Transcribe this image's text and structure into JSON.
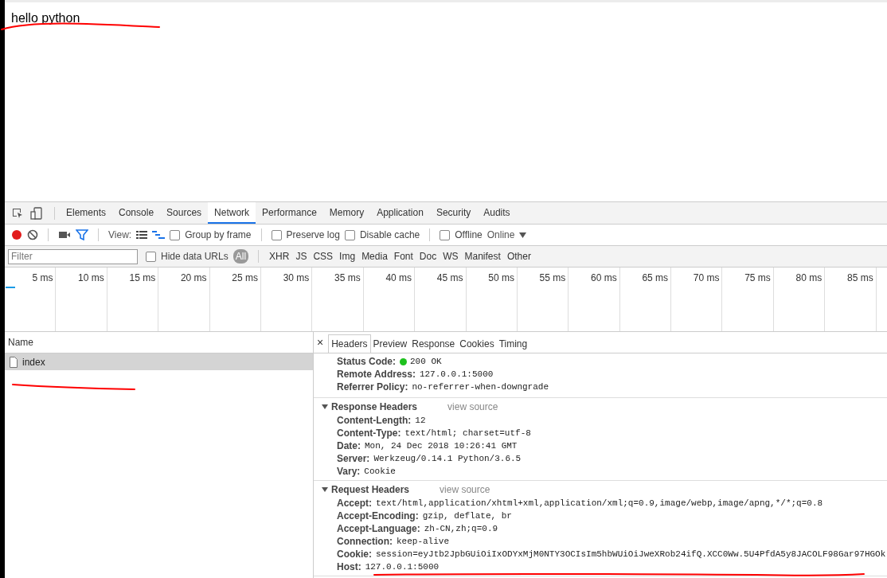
{
  "page": {
    "text": "hello python"
  },
  "devtools": {
    "tabs": [
      {
        "label": "Elements",
        "selected": false
      },
      {
        "label": "Console",
        "selected": false
      },
      {
        "label": "Sources",
        "selected": false
      },
      {
        "label": "Network",
        "selected": true
      },
      {
        "label": "Performance",
        "selected": false
      },
      {
        "label": "Memory",
        "selected": false
      },
      {
        "label": "Application",
        "selected": false
      },
      {
        "label": "Security",
        "selected": false
      },
      {
        "label": "Audits",
        "selected": false
      }
    ],
    "toolbar": {
      "recording": true,
      "view_label": "View:",
      "checkboxes": [
        {
          "label": "Group by frame",
          "checked": false
        },
        {
          "label": "Preserve log",
          "checked": false
        },
        {
          "label": "Disable cache",
          "checked": false
        },
        {
          "label": "Offline",
          "checked": false
        }
      ],
      "throttling": "Online"
    },
    "filter_bar": {
      "placeholder": "Filter",
      "hide_data_urls": {
        "label": "Hide data URLs",
        "checked": false
      },
      "types": [
        {
          "label": "All",
          "selected": true
        },
        {
          "label": "XHR",
          "selected": false
        },
        {
          "label": "JS",
          "selected": false
        },
        {
          "label": "CSS",
          "selected": false
        },
        {
          "label": "Img",
          "selected": false
        },
        {
          "label": "Media",
          "selected": false
        },
        {
          "label": "Font",
          "selected": false
        },
        {
          "label": "Doc",
          "selected": false
        },
        {
          "label": "WS",
          "selected": false
        },
        {
          "label": "Manifest",
          "selected": false
        },
        {
          "label": "Other",
          "selected": false
        }
      ]
    },
    "timeline_ticks": [
      "5 ms",
      "10 ms",
      "15 ms",
      "20 ms",
      "25 ms",
      "30 ms",
      "35 ms",
      "40 ms",
      "45 ms",
      "50 ms",
      "55 ms",
      "60 ms",
      "65 ms",
      "70 ms",
      "75 ms",
      "80 ms",
      "85 ms"
    ],
    "requests": {
      "column": "Name",
      "rows": [
        {
          "name": "index",
          "selected": true
        }
      ]
    },
    "detail_close": "×",
    "detail_tabs": [
      {
        "label": "Headers",
        "selected": true
      },
      {
        "label": "Preview",
        "selected": false
      },
      {
        "label": "Response",
        "selected": false
      },
      {
        "label": "Cookies",
        "selected": false
      },
      {
        "label": "Timing",
        "selected": false
      }
    ],
    "general_rows": [
      {
        "key": "Status Code:",
        "value": "200 OK",
        "kind": "status"
      },
      {
        "key": "Remote Address:",
        "value": "127.0.0.1:5000",
        "kind": "plain"
      },
      {
        "key": "Referrer Policy:",
        "value": "no-referrer-when-downgrade",
        "kind": "plain"
      }
    ],
    "sections": [
      {
        "title": "Response Headers",
        "link": "view source",
        "expanded": true,
        "rows": [
          {
            "key": "Content-Length:",
            "value": "12"
          },
          {
            "key": "Content-Type:",
            "value": "text/html; charset=utf-8"
          },
          {
            "key": "Date:",
            "value": "Mon, 24 Dec 2018 10:26:41 GMT"
          },
          {
            "key": "Server:",
            "value": "Werkzeug/0.14.1 Python/3.6.5"
          },
          {
            "key": "Vary:",
            "value": "Cookie"
          }
        ]
      },
      {
        "title": "Request Headers",
        "link": "view source",
        "expanded": true,
        "rows": [
          {
            "key": "Accept:",
            "value": "text/html,application/xhtml+xml,application/xml;q=0.9,image/webp,image/apng,*/*;q=0.8"
          },
          {
            "key": "Accept-Encoding:",
            "value": "gzip, deflate, br"
          },
          {
            "key": "Accept-Language:",
            "value": "zh-CN,zh;q=0.9"
          },
          {
            "key": "Connection:",
            "value": "keep-alive"
          },
          {
            "key": "Cookie:",
            "value": "session=eyJtb2JpbGUiOiIxODYxMjM0NTY3OCIsIm5hbWUiOiJweXRob24ifQ.XCC0Ww.5U4PfdA5y8JACOLF98Gar97HGOk"
          },
          {
            "key": "Host:",
            "value": "127.0.0.1:5000"
          }
        ]
      }
    ]
  }
}
